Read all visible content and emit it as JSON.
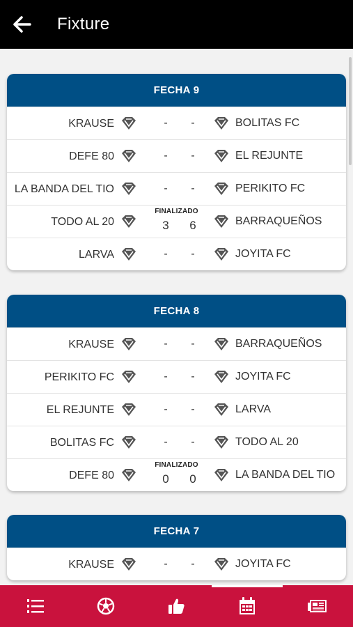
{
  "header": {
    "title": "Fixture"
  },
  "rounds": [
    {
      "title": "FECHA 9",
      "matches": [
        {
          "home": "KRAUSE",
          "away": "BOLITAS FC",
          "status": "",
          "home_score": "-",
          "away_score": "-"
        },
        {
          "home": "DEFE 80",
          "away": "EL REJUNTE",
          "status": "",
          "home_score": "-",
          "away_score": "-"
        },
        {
          "home": "LA BANDA DEL TIO",
          "away": "PERIKITO FC",
          "status": "",
          "home_score": "-",
          "away_score": "-"
        },
        {
          "home": "TODO AL 20",
          "away": "BARRAQUEÑOS",
          "status": "FINALIZADO",
          "home_score": "3",
          "away_score": "6"
        },
        {
          "home": "LARVA",
          "away": "JOYITA FC",
          "status": "",
          "home_score": "-",
          "away_score": "-"
        }
      ]
    },
    {
      "title": "FECHA 8",
      "matches": [
        {
          "home": "KRAUSE",
          "away": "BARRAQUEÑOS",
          "status": "",
          "home_score": "-",
          "away_score": "-"
        },
        {
          "home": "PERIKITO FC",
          "away": "JOYITA FC",
          "status": "",
          "home_score": "-",
          "away_score": "-"
        },
        {
          "home": "EL REJUNTE",
          "away": "LARVA",
          "status": "",
          "home_score": "-",
          "away_score": "-"
        },
        {
          "home": "BOLITAS FC",
          "away": "TODO AL 20",
          "status": "",
          "home_score": "-",
          "away_score": "-"
        },
        {
          "home": "DEFE 80",
          "away": "LA BANDA DEL TIO",
          "status": "FINALIZADO",
          "home_score": "0",
          "away_score": "0"
        }
      ]
    },
    {
      "title": "FECHA 7",
      "matches": [
        {
          "home": "KRAUSE",
          "away": "JOYITA FC",
          "status": "",
          "home_score": "-",
          "away_score": "-"
        }
      ]
    }
  ],
  "bottom_nav": [
    {
      "icon": "list-numbered-icon",
      "active": false
    },
    {
      "icon": "soccer-ball-icon",
      "active": false
    },
    {
      "icon": "thumbs-up-icon",
      "active": false
    },
    {
      "icon": "calendar-icon",
      "active": true
    },
    {
      "icon": "newspaper-icon",
      "active": false
    }
  ],
  "colors": {
    "top_bar": "#000000",
    "card_header": "#004f85",
    "bottom_bar": "#c9123d",
    "background": "#f2f2f2"
  }
}
